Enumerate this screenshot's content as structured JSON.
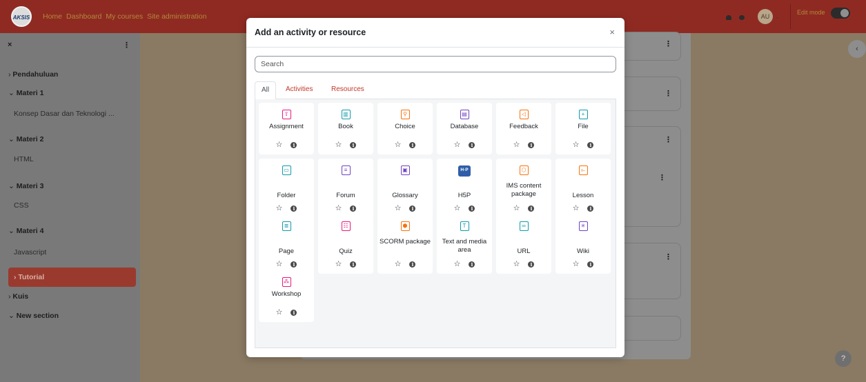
{
  "navbar": {
    "logo_text": "AKSIS",
    "links": [
      "Home",
      "Dashboard",
      "My courses",
      "Site administration"
    ],
    "avatar_initials": "AU",
    "edit_mode_label": "Edit mode"
  },
  "sidebar": {
    "items": [
      {
        "label": "Pendahuluan",
        "kind": "section",
        "chev": "›"
      },
      {
        "label": "Materi 1",
        "kind": "section",
        "chev": "⌄"
      },
      {
        "label": "Konsep Dasar dan Teknologi ...",
        "kind": "sub"
      },
      {
        "label": "Materi 2",
        "kind": "section",
        "chev": "⌄"
      },
      {
        "label": "HTML",
        "kind": "sub"
      },
      {
        "label": "Materi 3",
        "kind": "section",
        "chev": "⌄"
      },
      {
        "label": "CSS",
        "kind": "sub"
      },
      {
        "label": "Materi 4",
        "kind": "section",
        "chev": "⌄"
      },
      {
        "label": "Javascript",
        "kind": "sub"
      },
      {
        "label": "Tutorial",
        "kind": "active",
        "chev": "›"
      },
      {
        "label": "Kuis",
        "kind": "section",
        "chev": "›"
      },
      {
        "label": "New section",
        "kind": "section",
        "chev": "⌄"
      }
    ]
  },
  "help_label": "?",
  "modal": {
    "title": "Add an activity or resource",
    "close_glyph": "×",
    "search_placeholder": "Search",
    "tabs": [
      "All",
      "Activities",
      "Resources"
    ],
    "items": [
      {
        "name": "Assignment",
        "icon": "assignment-icon",
        "color": "#e6197f",
        "glyph": "⇧"
      },
      {
        "name": "Book",
        "icon": "book-icon",
        "color": "#0f9aaa",
        "glyph": "▥"
      },
      {
        "name": "Choice",
        "icon": "choice-icon",
        "color": "#f7730d",
        "glyph": "⚲"
      },
      {
        "name": "Database",
        "icon": "database-icon",
        "color": "#6f42c1",
        "glyph": "▤"
      },
      {
        "name": "Feedback",
        "icon": "feedback-icon",
        "color": "#f7730d",
        "glyph": "◁"
      },
      {
        "name": "File",
        "icon": "file-icon",
        "color": "#0f9aaa",
        "glyph": "+"
      },
      {
        "name": "Folder",
        "icon": "folder-icon",
        "color": "#0f9aaa",
        "glyph": "▭"
      },
      {
        "name": "Forum",
        "icon": "forum-icon",
        "color": "#6f42c1",
        "glyph": "≡"
      },
      {
        "name": "Glossary",
        "icon": "glossary-icon",
        "color": "#6f42c1",
        "glyph": "▣"
      },
      {
        "name": "H5P",
        "icon": "h5p-icon",
        "color": "#2e5ea8",
        "glyph": "H·P"
      },
      {
        "name": "IMS content package",
        "icon": "ims-package-icon",
        "color": "#f7730d",
        "glyph": "⬡"
      },
      {
        "name": "Lesson",
        "icon": "lesson-icon",
        "color": "#f7730d",
        "glyph": "⟜"
      },
      {
        "name": "Page",
        "icon": "page-icon",
        "color": "#0f9aaa",
        "glyph": "≣"
      },
      {
        "name": "Quiz",
        "icon": "quiz-icon",
        "color": "#e6197f",
        "glyph": "☷"
      },
      {
        "name": "SCORM package",
        "icon": "scorm-icon",
        "color": "#f7730d",
        "glyph": "⬢"
      },
      {
        "name": "Text and media area",
        "icon": "text-media-icon",
        "color": "#0f9aaa",
        "glyph": "T"
      },
      {
        "name": "URL",
        "icon": "url-icon",
        "color": "#0f9aaa",
        "glyph": "∞"
      },
      {
        "name": "Wiki",
        "icon": "wiki-icon",
        "color": "#6f42c1",
        "glyph": "✳"
      },
      {
        "name": "Workshop",
        "icon": "workshop-icon",
        "color": "#e6197f",
        "glyph": "⁂"
      }
    ],
    "star_glyph": "☆",
    "info_glyph": "i"
  }
}
